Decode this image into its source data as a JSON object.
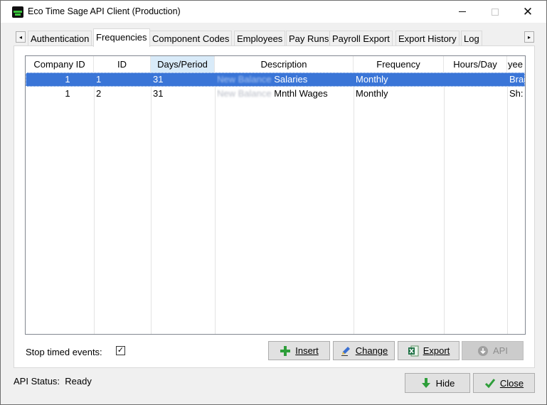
{
  "window": {
    "title": "Eco Time Sage API Client (Production)",
    "minimize_glyph": "—",
    "close_glyph": "✕"
  },
  "tabs": [
    {
      "label": "Authentication"
    },
    {
      "label": "Frequencies",
      "active": true
    },
    {
      "label": "Component Codes"
    },
    {
      "label": "Employees"
    },
    {
      "label": "Pay Runs"
    },
    {
      "label": "Payroll Export"
    },
    {
      "label": "Export History"
    },
    {
      "label": "Log"
    }
  ],
  "tab_scroll": {
    "left": "◂",
    "right": "▸"
  },
  "grid": {
    "sorted_column": "Days/Period",
    "columns": [
      "Company ID",
      "ID",
      "Days/Period",
      "Description",
      "Frequency",
      "Hours/Day",
      "yee"
    ],
    "rows": [
      {
        "company_id": "1",
        "id": "1",
        "days_period": "31",
        "desc_blurred": "New Balance",
        "desc": "Salaries",
        "frequency": "Monthly",
        "hours_day": "",
        "employee": "Brai",
        "selected": true
      },
      {
        "company_id": "1",
        "id": "2",
        "days_period": "31",
        "desc_blurred": "New Balance",
        "desc": "Mnthl Wages",
        "frequency": "Monthly",
        "hours_day": "",
        "employee": "Sh:",
        "selected": false
      }
    ]
  },
  "options": {
    "stop_timed_events_label": "Stop timed events:",
    "stop_timed_events_checked": true,
    "check_glyph": "✓"
  },
  "buttons": {
    "insert": "Insert",
    "change": "Change",
    "export": "Export",
    "api": "API",
    "hide": "Hide",
    "close": "Close"
  },
  "status": {
    "label": "API Status:",
    "value": "Ready"
  },
  "icons": {
    "insert": "plus-icon",
    "change": "pencil-icon",
    "export": "excel-icon",
    "api": "cloud-download-icon",
    "hide": "arrow-down-icon",
    "close": "checkmark-icon"
  },
  "colors": {
    "selection": "#3a75d7",
    "sorted_header": "#d9ebf9",
    "green_icon": "#2e9e3a",
    "pencil": "#3a6fd1"
  }
}
